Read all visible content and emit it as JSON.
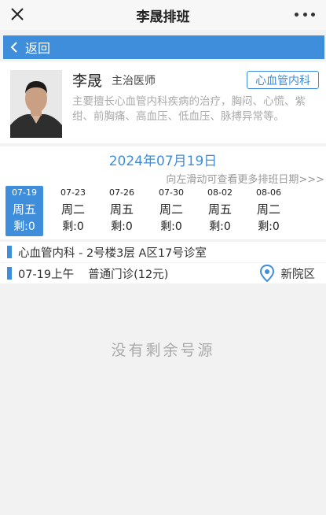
{
  "header": {
    "title": "李晟排班"
  },
  "back": {
    "label": "返回"
  },
  "doctor": {
    "name": "李晟",
    "title": "主治医师",
    "department": "心血管内科",
    "intro": "主要擅长心血管内科疾病的治疗，胸闷、心慌、紫绀、前胸痛、高血压、低血压、脉搏异常等。"
  },
  "schedule": {
    "current_date": "2024年07月19日",
    "hint": "向左滑动可查看更多排班日期>>>",
    "days": [
      {
        "date": "07-19",
        "weekday": "周五",
        "remaining": "剩:0",
        "selected": true
      },
      {
        "date": "07-23",
        "weekday": "周二",
        "remaining": "剩:0",
        "selected": false
      },
      {
        "date": "07-26",
        "weekday": "周五",
        "remaining": "剩:0",
        "selected": false
      },
      {
        "date": "07-30",
        "weekday": "周二",
        "remaining": "剩:0",
        "selected": false
      },
      {
        "date": "08-02",
        "weekday": "周五",
        "remaining": "剩:0",
        "selected": false
      },
      {
        "date": "08-06",
        "weekday": "周二",
        "remaining": "剩:0",
        "selected": false
      }
    ]
  },
  "clinic": {
    "location": "心血管内科 - 2号楼3层 A区17号诊室",
    "session": "07-19上午",
    "type": "普通门诊(12元)",
    "campus": "新院区"
  },
  "empty_message": "没有剩余号源",
  "colors": {
    "accent": "#3e8edc",
    "muted_text": "#aaaaaa"
  }
}
